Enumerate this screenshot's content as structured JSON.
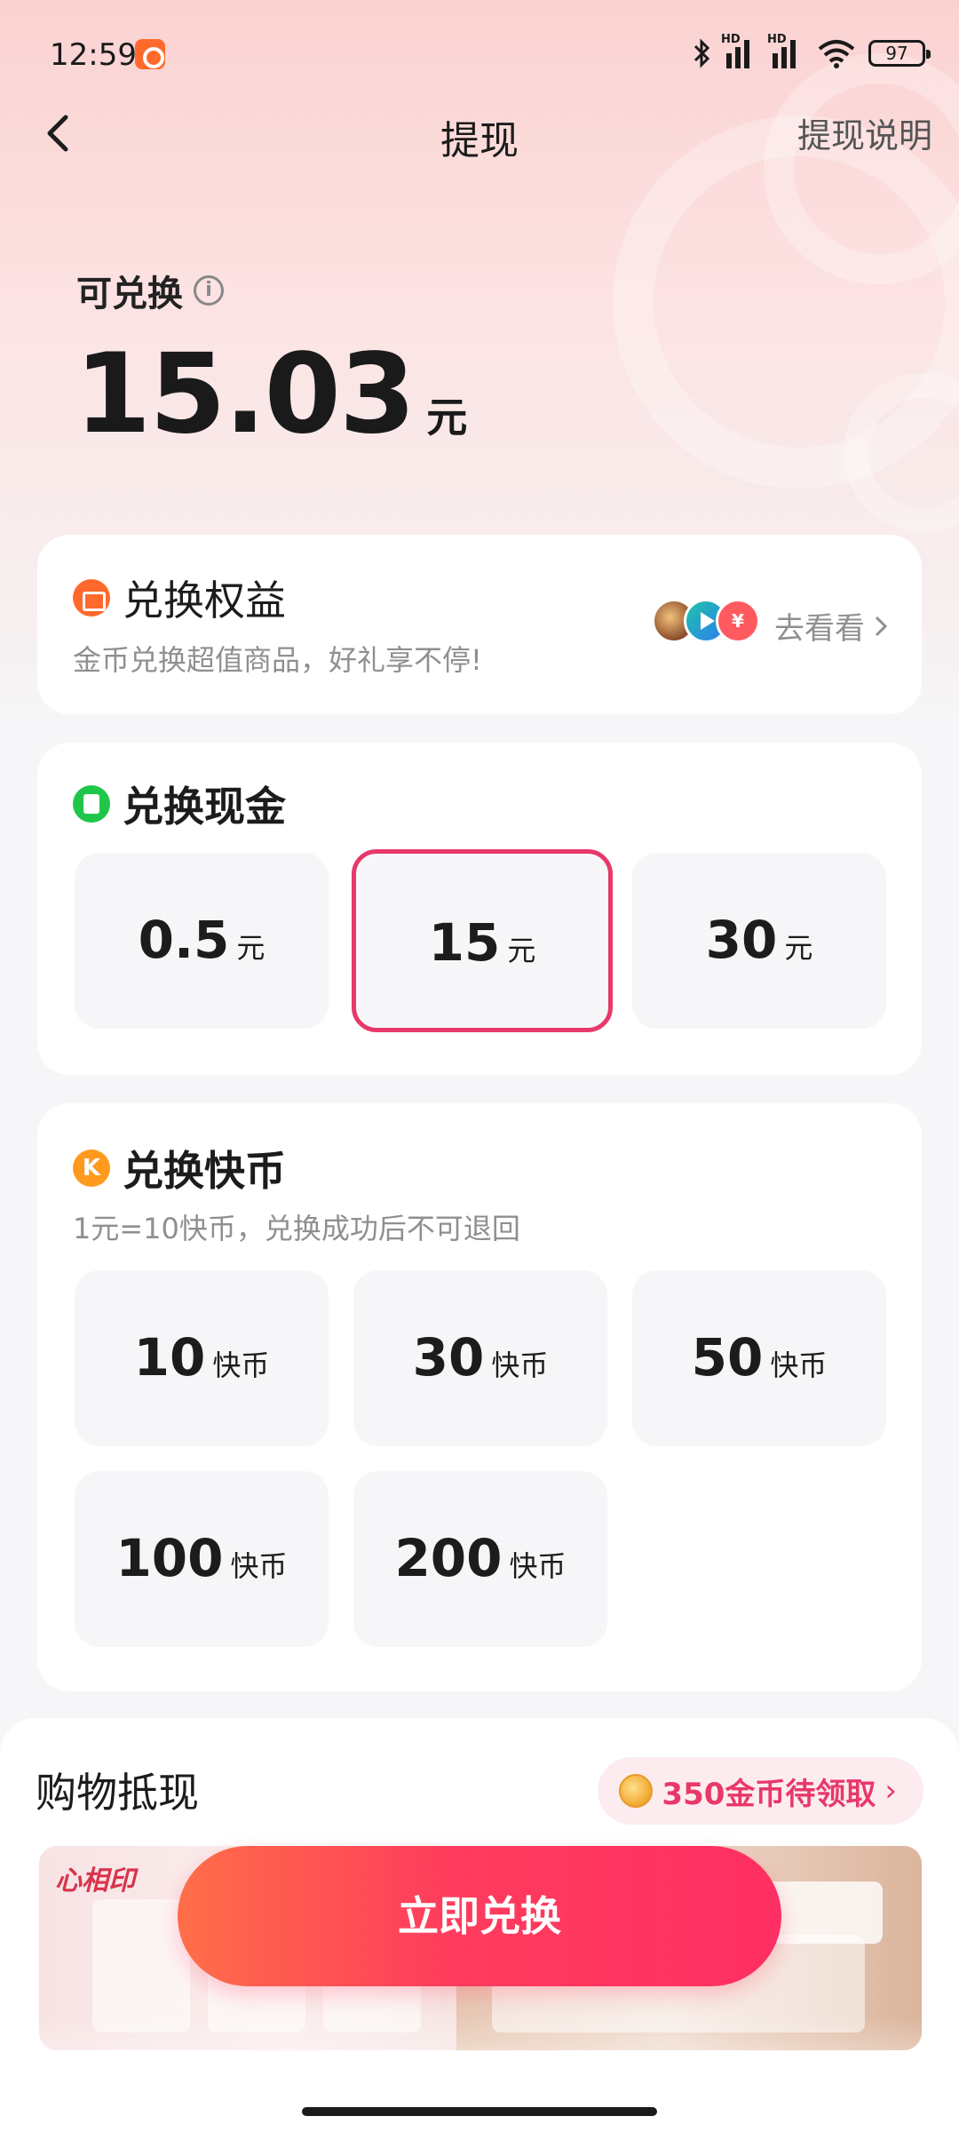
{
  "status_bar": {
    "time": "12:59",
    "network_label": "HD",
    "battery": "97"
  },
  "header": {
    "title": "提现",
    "help_link": "提现说明"
  },
  "balance": {
    "label": "可兑换",
    "amount": "15.03",
    "unit": "元"
  },
  "benefits": {
    "title": "兑换权益",
    "subtitle": "金币兑换超值商品，好礼享不停!",
    "link": "去看看",
    "avatar_badge": "¥"
  },
  "cash": {
    "title": "兑换现金",
    "options": [
      {
        "value": "0.5",
        "unit": "元",
        "selected": false
      },
      {
        "value": "15",
        "unit": "元",
        "selected": true
      },
      {
        "value": "30",
        "unit": "元",
        "selected": false
      }
    ]
  },
  "coins": {
    "icon_letter": "K",
    "title": "兑换快币",
    "subtitle": "1元=10快币，兑换成功后不可退回",
    "options": [
      {
        "value": "10",
        "unit": "快币"
      },
      {
        "value": "30",
        "unit": "快币"
      },
      {
        "value": "50",
        "unit": "快币"
      },
      {
        "value": "100",
        "unit": "快币"
      },
      {
        "value": "200",
        "unit": "快币"
      }
    ]
  },
  "shopping": {
    "title": "购物抵现",
    "reward": "350金币待领取",
    "brand": "心相印"
  },
  "cta": {
    "label": "立即兑换"
  },
  "colors": {
    "accent": "#e8386a",
    "cta_start": "#ff6e48",
    "cta_end": "#fe2f63",
    "page_bg": "#f6f6f8"
  }
}
